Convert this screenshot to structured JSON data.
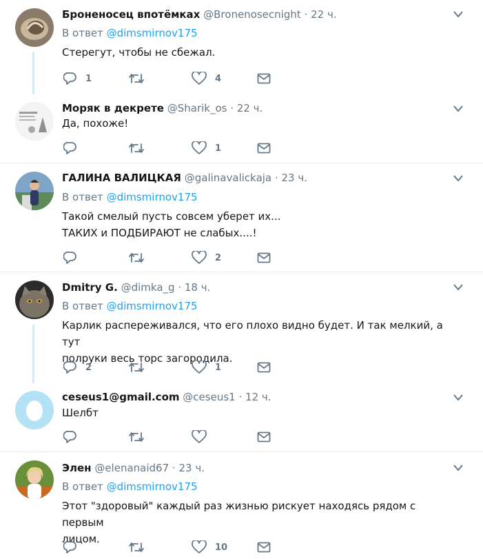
{
  "reply_prefix": "В ответ",
  "tweets": [
    {
      "name": "Броненосец впотёмках",
      "handle": "@Bronenosecnight",
      "time": "22 ч.",
      "reply_to": "@dimsmirnov175",
      "text": [
        "Стерегут, чтобы не сбежал."
      ],
      "replies": "1",
      "retweets": "",
      "likes": "4"
    },
    {
      "name": "Моряк в декрете",
      "handle": "@Sharik_os",
      "time": "22 ч.",
      "reply_to": "",
      "text": [
        "Да, похоже!"
      ],
      "replies": "",
      "retweets": "",
      "likes": "1"
    },
    {
      "name": "ГАЛИНА ВАЛИЦКАЯ",
      "handle": "@galinavalickaja",
      "time": "23 ч.",
      "reply_to": "@dimsmirnov175",
      "text": [
        "Такой смелый пусть совсем уберет их...",
        "ТАКИХ и ПОДБИРАЮТ не слабых....!"
      ],
      "replies": "",
      "retweets": "",
      "likes": "2"
    },
    {
      "name": "Dmitry G.",
      "handle": "@dimka_g",
      "time": "18 ч.",
      "reply_to": "@dimsmirnov175",
      "text": [
        "Карлик распереживался, что его плохо видно будет. И так мелкий, а тут",
        "полруки весь торс загородила."
      ],
      "replies": "2",
      "retweets": "",
      "likes": "1"
    },
    {
      "name": "ceseus1@gmail.com",
      "handle": "@ceseus1",
      "time": "12 ч.",
      "reply_to": "",
      "text": [
        "Шелбт"
      ],
      "replies": "",
      "retweets": "",
      "likes": ""
    },
    {
      "name": "Элен",
      "handle": "@elenanaid67",
      "time": "23 ч.",
      "reply_to": "@dimsmirnov175",
      "text": [
        "Этот \"здоровый\" каждый раз жизнью рискует находясь рядом с первым",
        "лицом."
      ],
      "replies": "",
      "retweets": "",
      "likes": "10"
    }
  ],
  "icons": {
    "reply": "reply-icon",
    "retweet": "retweet-icon",
    "like": "heart-icon",
    "message": "envelope-icon",
    "more": "chevron-down-icon"
  },
  "colors": {
    "icon_gray": "#657786",
    "link_blue": "#1da1f2",
    "thread_line": "#c4eef8",
    "divider": "#e6ecf0"
  }
}
